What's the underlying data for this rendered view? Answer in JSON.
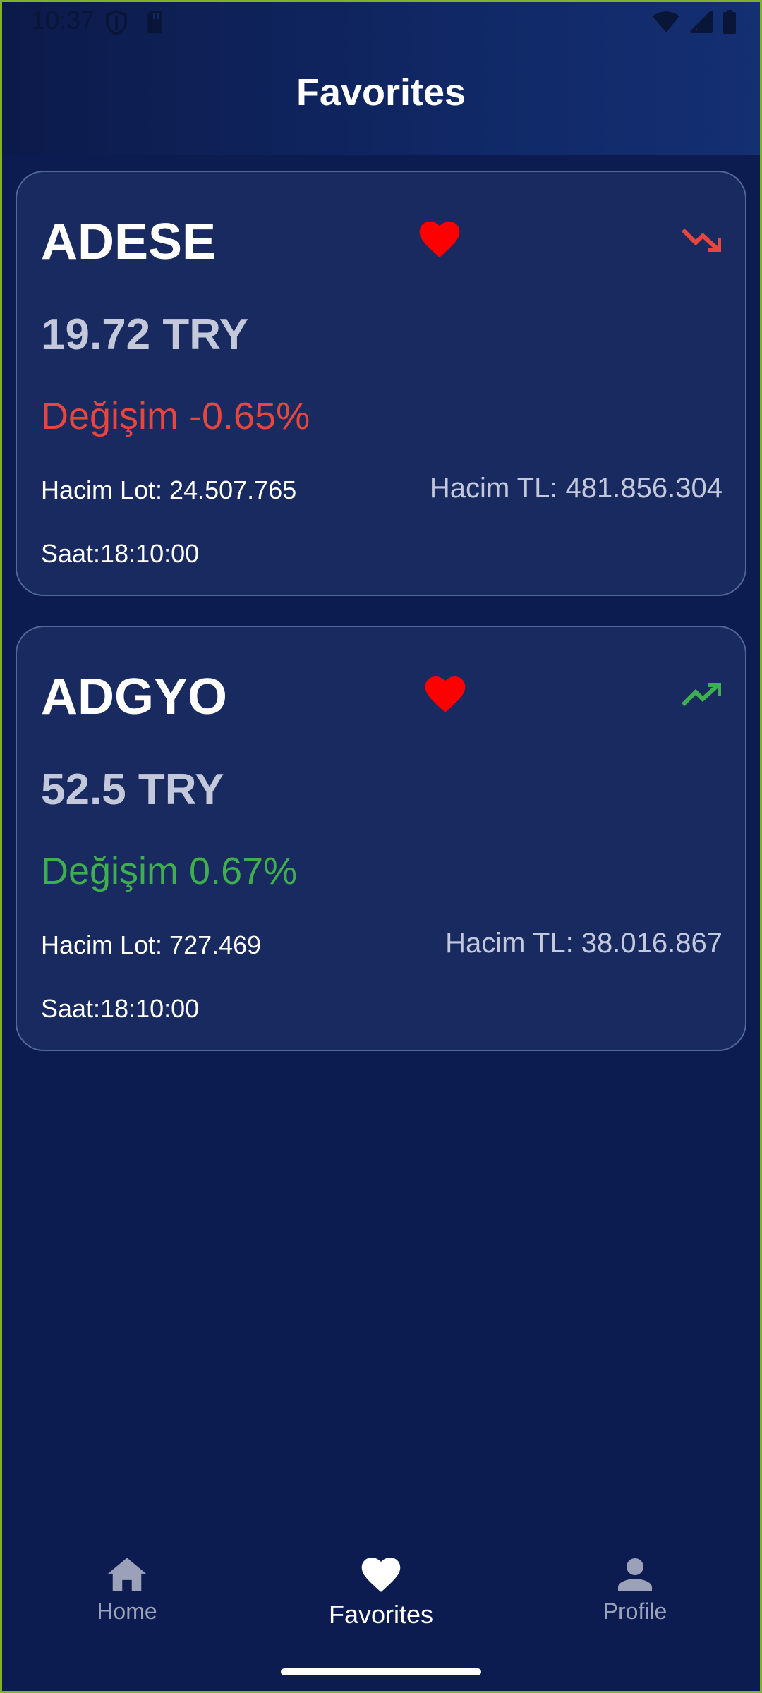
{
  "status_bar": {
    "time": "10:37",
    "icons": [
      "shield-icon",
      "sd-card-icon",
      "wifi-icon",
      "signal-icon",
      "battery-icon"
    ]
  },
  "header": {
    "title": "Favorites"
  },
  "colors": {
    "background": "#0d1c50",
    "card": "#182a60",
    "down": "#e8453c",
    "up": "#3fae4f",
    "heart": "#ff0000"
  },
  "stocks": [
    {
      "symbol": "ADESE",
      "price": "19.72 TRY",
      "change": "Değişim -0.65%",
      "trend": "trending-down-icon",
      "volume_lot": "Hacim Lot: 24.507.765",
      "volume_tl": "Hacim TL: 481.856.304",
      "time": "Saat:18:10:00"
    },
    {
      "symbol": "ADGYO",
      "price": "52.5 TRY",
      "change": "Değişim 0.67%",
      "trend": "trending-up-icon",
      "volume_lot": "Hacim Lot: 727.469",
      "volume_tl": "Hacim TL: 38.016.867",
      "time": "Saat:18:10:00"
    }
  ],
  "bottom_nav": {
    "items": [
      {
        "label": "Home",
        "icon": "home-icon",
        "active": false
      },
      {
        "label": "Favorites",
        "icon": "heart-icon",
        "active": true
      },
      {
        "label": "Profile",
        "icon": "person-icon",
        "active": false
      }
    ]
  }
}
